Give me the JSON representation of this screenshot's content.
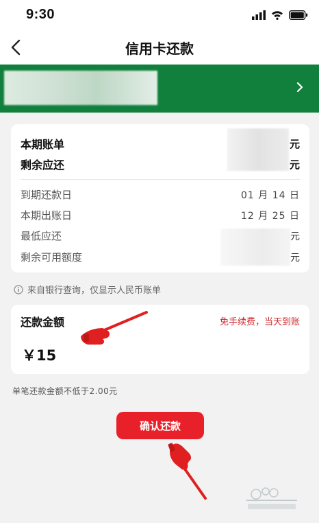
{
  "status_bar": {
    "time": "9:30"
  },
  "nav": {
    "title": "信用卡还款"
  },
  "bill": {
    "current_bill_label": "本期账单",
    "current_bill_unit": "元",
    "remaining_due_label": "剩余应还",
    "remaining_due_unit": "元",
    "due_date_label": "到期还款日",
    "due_date_value": "01 月 14 日",
    "statement_date_label": "本期出账日",
    "statement_date_value": "12 月 25 日",
    "minimum_due_label": "最低应还",
    "minimum_due_unit": "元",
    "available_credit_label": "剩余可用额度",
    "available_credit_unit": "元"
  },
  "notice": {
    "text": "来自银行查询，仅显示人民币账单"
  },
  "repay": {
    "amount_label": "还款金额",
    "fee_note": "免手续费，当天到账",
    "amount_value": "￥15"
  },
  "min_note": "单笔还款金额不低于2.00元",
  "confirm_button": "确认还款",
  "colors": {
    "brand_green": "#12803d",
    "accent_red": "#e8202a",
    "note_red": "#d0262b"
  },
  "icons": [
    "back-chevron-icon",
    "chevron-right-icon",
    "info-icon",
    "signal-icon",
    "wifi-icon",
    "battery-icon"
  ]
}
